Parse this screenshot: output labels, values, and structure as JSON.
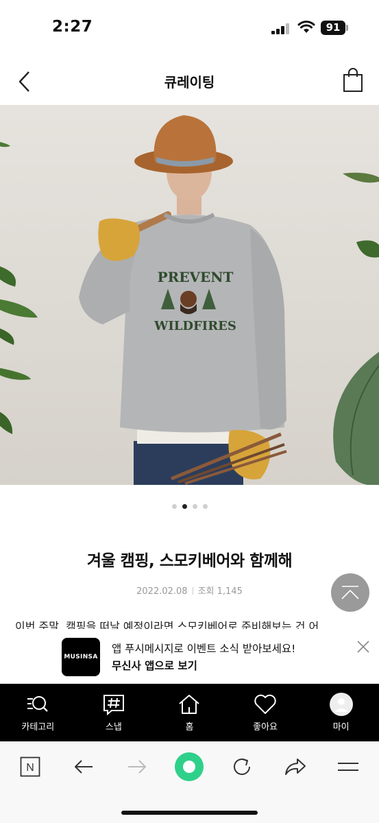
{
  "status_bar": {
    "time": "2:27",
    "battery": "91"
  },
  "header": {
    "title": "큐레이팅"
  },
  "hero": {
    "sweatshirt_text_top": "PREVENT",
    "sweatshirt_text_bottom": "WILDFIRES"
  },
  "carousel": {
    "count": 4,
    "active_index": 1
  },
  "article": {
    "title": "겨울 캠핑, 스모키베어와 함께해",
    "date": "2022.02.08",
    "views": "조회 1,145",
    "body": "이번 주말, 캠핑을 떠날 예정이라면 스모키베어로 준비해보는 건 어"
  },
  "app_banner": {
    "logo": "MUSINSA",
    "line1": "앱 푸시메시지로 이벤트 소식 받아보세요!",
    "line2": "무신사 앱으로 보기"
  },
  "tabbar": [
    {
      "label": "카테고리",
      "icon": "category-search-icon"
    },
    {
      "label": "스냅",
      "icon": "hashtag-icon"
    },
    {
      "label": "홈",
      "icon": "home-icon"
    },
    {
      "label": "좋아요",
      "icon": "heart-icon"
    },
    {
      "label": "마이",
      "icon": "avatar-icon"
    }
  ],
  "browser_bar": {
    "icons": [
      "naver-n-icon",
      "back-arrow-icon",
      "forward-arrow-icon",
      "green-dot-icon",
      "reload-icon",
      "share-icon",
      "menu-icon"
    ],
    "n_label": "N"
  },
  "colors": {
    "tab_bg": "#000000",
    "green_button": "#2fd08a",
    "scroll_top_bg": "#9a9a9a"
  }
}
